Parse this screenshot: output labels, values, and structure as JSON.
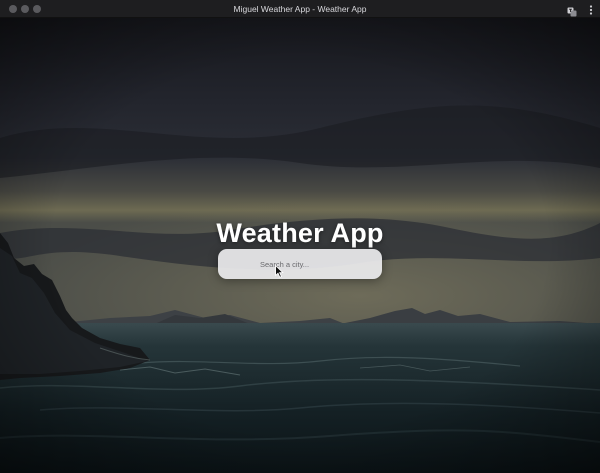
{
  "window": {
    "title": "Miguel Weather App - Weather App"
  },
  "toolbar": {
    "icons": [
      "translate-icon",
      "more-vertical-icon"
    ]
  },
  "app": {
    "heading": "Weather App"
  },
  "search": {
    "placeholder": "Search a city...",
    "value": ""
  },
  "colors": {
    "titlebar": "#1e1e20",
    "heading": "#ffffff",
    "search_bg": "#ebebee",
    "sky_dark": "#1f222b",
    "sea": "#1c2a30"
  }
}
